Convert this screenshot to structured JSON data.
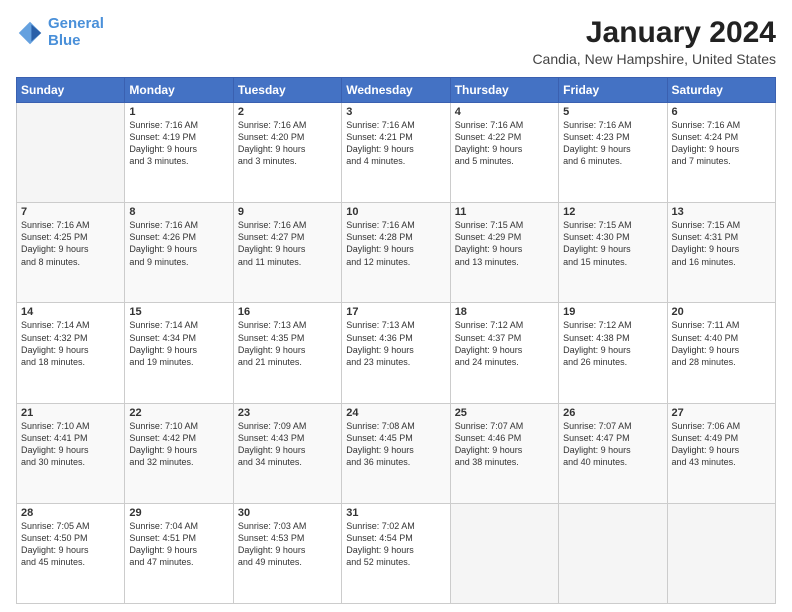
{
  "logo": {
    "line1": "General",
    "line2": "Blue"
  },
  "title": "January 2024",
  "subtitle": "Candia, New Hampshire, United States",
  "weekdays": [
    "Sunday",
    "Monday",
    "Tuesday",
    "Wednesday",
    "Thursday",
    "Friday",
    "Saturday"
  ],
  "weeks": [
    [
      {
        "day": "",
        "content": ""
      },
      {
        "day": "1",
        "content": "Sunrise: 7:16 AM\nSunset: 4:19 PM\nDaylight: 9 hours\nand 3 minutes."
      },
      {
        "day": "2",
        "content": "Sunrise: 7:16 AM\nSunset: 4:20 PM\nDaylight: 9 hours\nand 3 minutes."
      },
      {
        "day": "3",
        "content": "Sunrise: 7:16 AM\nSunset: 4:21 PM\nDaylight: 9 hours\nand 4 minutes."
      },
      {
        "day": "4",
        "content": "Sunrise: 7:16 AM\nSunset: 4:22 PM\nDaylight: 9 hours\nand 5 minutes."
      },
      {
        "day": "5",
        "content": "Sunrise: 7:16 AM\nSunset: 4:23 PM\nDaylight: 9 hours\nand 6 minutes."
      },
      {
        "day": "6",
        "content": "Sunrise: 7:16 AM\nSunset: 4:24 PM\nDaylight: 9 hours\nand 7 minutes."
      }
    ],
    [
      {
        "day": "7",
        "content": "Sunrise: 7:16 AM\nSunset: 4:25 PM\nDaylight: 9 hours\nand 8 minutes."
      },
      {
        "day": "8",
        "content": "Sunrise: 7:16 AM\nSunset: 4:26 PM\nDaylight: 9 hours\nand 9 minutes."
      },
      {
        "day": "9",
        "content": "Sunrise: 7:16 AM\nSunset: 4:27 PM\nDaylight: 9 hours\nand 11 minutes."
      },
      {
        "day": "10",
        "content": "Sunrise: 7:16 AM\nSunset: 4:28 PM\nDaylight: 9 hours\nand 12 minutes."
      },
      {
        "day": "11",
        "content": "Sunrise: 7:15 AM\nSunset: 4:29 PM\nDaylight: 9 hours\nand 13 minutes."
      },
      {
        "day": "12",
        "content": "Sunrise: 7:15 AM\nSunset: 4:30 PM\nDaylight: 9 hours\nand 15 minutes."
      },
      {
        "day": "13",
        "content": "Sunrise: 7:15 AM\nSunset: 4:31 PM\nDaylight: 9 hours\nand 16 minutes."
      }
    ],
    [
      {
        "day": "14",
        "content": "Sunrise: 7:14 AM\nSunset: 4:32 PM\nDaylight: 9 hours\nand 18 minutes."
      },
      {
        "day": "15",
        "content": "Sunrise: 7:14 AM\nSunset: 4:34 PM\nDaylight: 9 hours\nand 19 minutes."
      },
      {
        "day": "16",
        "content": "Sunrise: 7:13 AM\nSunset: 4:35 PM\nDaylight: 9 hours\nand 21 minutes."
      },
      {
        "day": "17",
        "content": "Sunrise: 7:13 AM\nSunset: 4:36 PM\nDaylight: 9 hours\nand 23 minutes."
      },
      {
        "day": "18",
        "content": "Sunrise: 7:12 AM\nSunset: 4:37 PM\nDaylight: 9 hours\nand 24 minutes."
      },
      {
        "day": "19",
        "content": "Sunrise: 7:12 AM\nSunset: 4:38 PM\nDaylight: 9 hours\nand 26 minutes."
      },
      {
        "day": "20",
        "content": "Sunrise: 7:11 AM\nSunset: 4:40 PM\nDaylight: 9 hours\nand 28 minutes."
      }
    ],
    [
      {
        "day": "21",
        "content": "Sunrise: 7:10 AM\nSunset: 4:41 PM\nDaylight: 9 hours\nand 30 minutes."
      },
      {
        "day": "22",
        "content": "Sunrise: 7:10 AM\nSunset: 4:42 PM\nDaylight: 9 hours\nand 32 minutes."
      },
      {
        "day": "23",
        "content": "Sunrise: 7:09 AM\nSunset: 4:43 PM\nDaylight: 9 hours\nand 34 minutes."
      },
      {
        "day": "24",
        "content": "Sunrise: 7:08 AM\nSunset: 4:45 PM\nDaylight: 9 hours\nand 36 minutes."
      },
      {
        "day": "25",
        "content": "Sunrise: 7:07 AM\nSunset: 4:46 PM\nDaylight: 9 hours\nand 38 minutes."
      },
      {
        "day": "26",
        "content": "Sunrise: 7:07 AM\nSunset: 4:47 PM\nDaylight: 9 hours\nand 40 minutes."
      },
      {
        "day": "27",
        "content": "Sunrise: 7:06 AM\nSunset: 4:49 PM\nDaylight: 9 hours\nand 43 minutes."
      }
    ],
    [
      {
        "day": "28",
        "content": "Sunrise: 7:05 AM\nSunset: 4:50 PM\nDaylight: 9 hours\nand 45 minutes."
      },
      {
        "day": "29",
        "content": "Sunrise: 7:04 AM\nSunset: 4:51 PM\nDaylight: 9 hours\nand 47 minutes."
      },
      {
        "day": "30",
        "content": "Sunrise: 7:03 AM\nSunset: 4:53 PM\nDaylight: 9 hours\nand 49 minutes."
      },
      {
        "day": "31",
        "content": "Sunrise: 7:02 AM\nSunset: 4:54 PM\nDaylight: 9 hours\nand 52 minutes."
      },
      {
        "day": "",
        "content": ""
      },
      {
        "day": "",
        "content": ""
      },
      {
        "day": "",
        "content": ""
      }
    ]
  ]
}
